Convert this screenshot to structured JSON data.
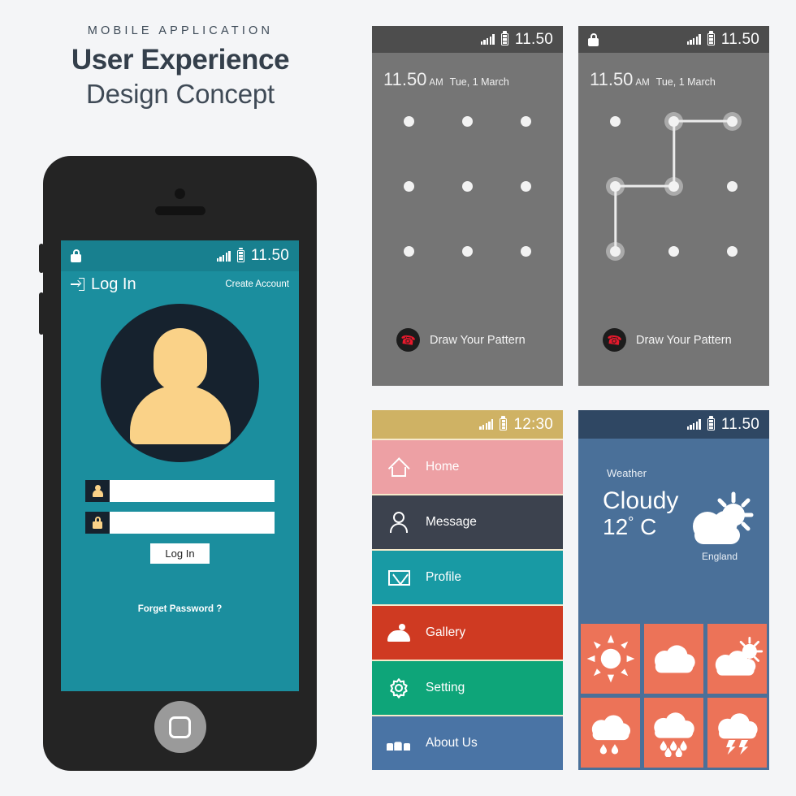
{
  "headline": {
    "eyebrow": "MOBILE APPLICATION",
    "line1": "User Experience",
    "line2": "Design Concept"
  },
  "login_screen": {
    "status_bar": {
      "lock_icon": "lock-icon",
      "signal_icon": "signal-icon",
      "battery_icon": "battery-icon",
      "time": "11.50"
    },
    "title": "Log In",
    "title_icon": "login-arrow-icon",
    "create_account": "Create Account",
    "avatar_icon": "avatar-placeholder-icon",
    "username_field": {
      "icon": "user-icon",
      "value": "",
      "placeholder": ""
    },
    "password_field": {
      "icon": "lock-icon",
      "value": "",
      "placeholder": ""
    },
    "login_button": "Log In",
    "forget_password": "Forget Password ?",
    "colors": {
      "body": "#1b8e9e",
      "status": "#18808f",
      "avatar_bg": "#16222e",
      "avatar_fg": "#fad288"
    }
  },
  "pattern_screen_1": {
    "status_bar": {
      "signal_icon": "signal-icon",
      "battery_icon": "battery-icon",
      "time": "11.50"
    },
    "clock": {
      "time": "11.50",
      "ampm": "AM",
      "date": "Tue, 1 March"
    },
    "dots": [
      {
        "row": 0,
        "col": 0,
        "active": false
      },
      {
        "row": 0,
        "col": 1,
        "active": false
      },
      {
        "row": 0,
        "col": 2,
        "active": false
      },
      {
        "row": 1,
        "col": 0,
        "active": false
      },
      {
        "row": 1,
        "col": 1,
        "active": false
      },
      {
        "row": 1,
        "col": 2,
        "active": false
      },
      {
        "row": 2,
        "col": 0,
        "active": false
      },
      {
        "row": 2,
        "col": 1,
        "active": false
      },
      {
        "row": 2,
        "col": 2,
        "active": false
      }
    ],
    "path": [],
    "footer_label": "Draw Your Pattern",
    "footer_icon": "phone-icon"
  },
  "pattern_screen_2": {
    "status_bar": {
      "lock_icon": "lock-icon",
      "signal_icon": "signal-icon",
      "battery_icon": "battery-icon",
      "time": "11.50"
    },
    "clock": {
      "time": "11.50",
      "ampm": "AM",
      "date": "Tue, 1 March"
    },
    "dots": [
      {
        "row": 0,
        "col": 0,
        "active": false
      },
      {
        "row": 0,
        "col": 1,
        "active": true
      },
      {
        "row": 0,
        "col": 2,
        "active": true
      },
      {
        "row": 1,
        "col": 0,
        "active": true
      },
      {
        "row": 1,
        "col": 1,
        "active": true
      },
      {
        "row": 1,
        "col": 2,
        "active": false
      },
      {
        "row": 2,
        "col": 0,
        "active": true
      },
      {
        "row": 2,
        "col": 1,
        "active": false
      },
      {
        "row": 2,
        "col": 2,
        "active": false
      }
    ],
    "path": [
      {
        "from": [
          0,
          2
        ],
        "to": [
          0,
          1
        ]
      },
      {
        "from": [
          0,
          1
        ],
        "to": [
          1,
          1
        ]
      },
      {
        "from": [
          1,
          1
        ],
        "to": [
          1,
          0
        ]
      },
      {
        "from": [
          1,
          0
        ],
        "to": [
          2,
          0
        ]
      }
    ],
    "footer_label": "Draw Your Pattern",
    "footer_icon": "phone-icon"
  },
  "menu_screen": {
    "status_bar": {
      "signal_icon": "signal-icon",
      "battery_icon": "battery-icon",
      "time": "12:30"
    },
    "status_color": "#cfb264",
    "divider_color": "#f6eacb",
    "items": [
      {
        "label": "Home",
        "icon": "house-icon",
        "color": "#eda0a4"
      },
      {
        "label": "Message",
        "icon": "person-icon",
        "color": "#3c424e"
      },
      {
        "label": "Profile",
        "icon": "envelope-icon",
        "color": "#189aa4"
      },
      {
        "label": "Gallery",
        "icon": "image-icon",
        "color": "#cf3a22"
      },
      {
        "label": "Setting",
        "icon": "gear-icon",
        "color": "#0ea579"
      },
      {
        "label": "About Us",
        "icon": "group-icon",
        "color": "#4a74a5"
      }
    ]
  },
  "weather_screen": {
    "status_bar": {
      "signal_icon": "signal-icon",
      "battery_icon": "battery-icon",
      "time": "11.50"
    },
    "section_label": "Weather",
    "condition": "Cloudy",
    "temperature": "12",
    "degree": "°",
    "unit": "C",
    "location": "England",
    "main_icon": "partly-cloudy-icon",
    "colors": {
      "body": "#4a7099",
      "status": "#2f4763",
      "tile": "#ec7358"
    },
    "forecast_tiles": [
      {
        "icon": "sun-icon"
      },
      {
        "icon": "cloud-icon"
      },
      {
        "icon": "partly-cloudy-icon"
      },
      {
        "icon": "light-rain-icon"
      },
      {
        "icon": "rain-icon"
      },
      {
        "icon": "thunderstorm-icon"
      }
    ]
  }
}
